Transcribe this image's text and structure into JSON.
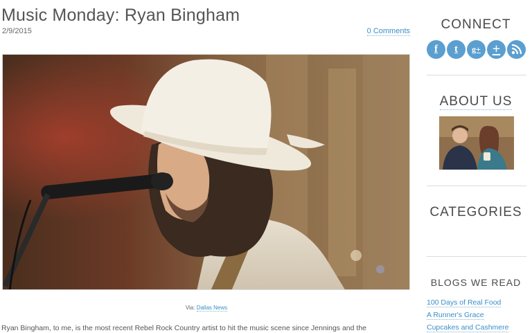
{
  "post": {
    "title": "Music Monday: Ryan Bingham",
    "date": "2/9/2015",
    "comments_link": "0 Comments",
    "photo_alt": "musician-with-hat-at-microphone",
    "caption_prefix": "Via: ",
    "caption_link": "Dallas News",
    "body_first_line": "Ryan Bingham, to me, is the most recent Rebel Rock Country artist to hit the music scene since Jennings and the"
  },
  "sidebar": {
    "connect": {
      "title": "CONNECT",
      "icons": [
        {
          "name": "facebook-icon",
          "glyph": "f"
        },
        {
          "name": "twitter-icon",
          "glyph": "t"
        },
        {
          "name": "google-plus-icon",
          "glyph": "g+"
        },
        {
          "name": "plus-icon",
          "glyph": "+"
        },
        {
          "name": "rss-icon",
          "glyph": ""
        }
      ],
      "icon_color": "#5a9fd0"
    },
    "about": {
      "title": "ABOUT US"
    },
    "categories": {
      "title": "CATEGORIES"
    },
    "blogs": {
      "title": "BLOGS WE READ",
      "items": [
        "100 Days of Real Food",
        "A Runner's Grace",
        "Cupcakes and Cashmere"
      ]
    }
  },
  "colors": {
    "link": "#3a8ec4",
    "heading": "#555555",
    "divider": "#dcdcdc"
  }
}
